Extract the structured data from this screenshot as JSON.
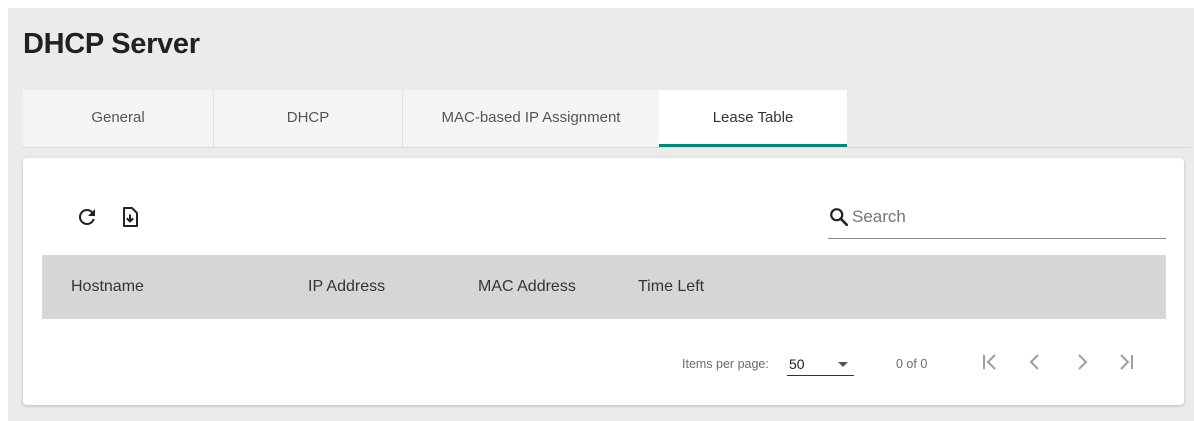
{
  "page": {
    "title": "DHCP Server"
  },
  "tabs": [
    {
      "label": "General"
    },
    {
      "label": "DHCP"
    },
    {
      "label": "MAC-based IP Assignment"
    },
    {
      "label": "Lease Table",
      "active": true
    }
  ],
  "toolbar": {
    "refresh_icon": "refresh-icon",
    "export_icon": "file-download-icon"
  },
  "search": {
    "placeholder": "Search",
    "value": "",
    "icon": "search-icon"
  },
  "table": {
    "columns": [
      "Hostname",
      "IP Address",
      "MAC Address",
      "Time Left"
    ],
    "rows": []
  },
  "paginator": {
    "items_per_page_label": "Items per page:",
    "items_per_page": "50",
    "range_label": "0 of 0"
  },
  "colors": {
    "accent": "#00897b",
    "header_bg": "#d6d6d4",
    "page_bg": "#ebebeb"
  }
}
